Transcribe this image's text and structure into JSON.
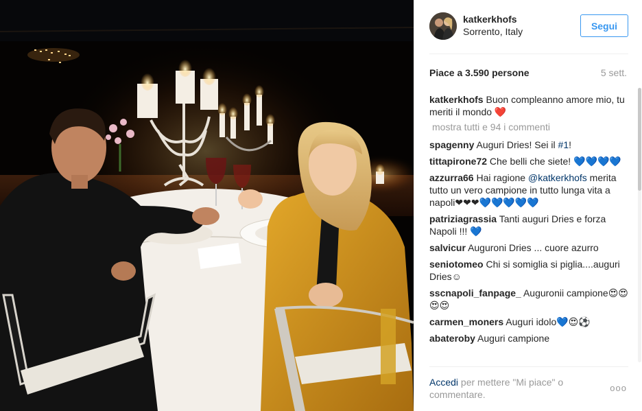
{
  "post": {
    "username": "katkerkhofs",
    "location": "Sorrento, Italy",
    "follow_label": "Segui",
    "likes_text": "Piace a 3.590 persone",
    "time_ago": "5 sett.",
    "caption_user": "katkerkhofs",
    "caption_text": "Buon compleanno amore mio, tu meriti il mondo ❤️",
    "show_all_comments": "mostra tutti e 94 i commenti",
    "comments": [
      {
        "user": "spagenny",
        "pre": "Auguri Dries! Sei il ",
        "mention": "#1",
        "post": "!"
      },
      {
        "user": "tittapirone72",
        "pre": "Che belli che siete! 💙💙💙💙",
        "mention": "",
        "post": ""
      },
      {
        "user": "azzurra66",
        "pre": "Hai ragione ",
        "mention": "@katkerkhofs",
        "post": " merita tutto un vero campione in tutto lunga vita a napoli❤❤❤💙💙💙💙💙"
      },
      {
        "user": "patriziagrassia",
        "pre": "Tanti auguri Dries e forza Napoli !!! 💙",
        "mention": "",
        "post": ""
      },
      {
        "user": "salvicur",
        "pre": "Auguroni Dries ... cuore azurro",
        "mention": "",
        "post": ""
      },
      {
        "user": "seniotomeo",
        "pre": "Chi si somiglia si piglia....auguri Dries☺",
        "mention": "",
        "post": ""
      },
      {
        "user": "sscnapoli_fanpage_",
        "pre": "Auguronii campione😍😍😍😍",
        "mention": "",
        "post": ""
      },
      {
        "user": "carmen_moners",
        "pre": "Auguri idolo💙😍⚽",
        "mention": "",
        "post": ""
      },
      {
        "user": "abateroby",
        "pre": "Auguri campione",
        "mention": "",
        "post": ""
      }
    ],
    "login_link": "Accedi",
    "login_rest": " per mettere \"Mi piace\" o commentare.",
    "more_options": "ooo"
  },
  "colors": {
    "link_blue": "#3897f0",
    "dark_link": "#003569",
    "muted": "#999999"
  }
}
